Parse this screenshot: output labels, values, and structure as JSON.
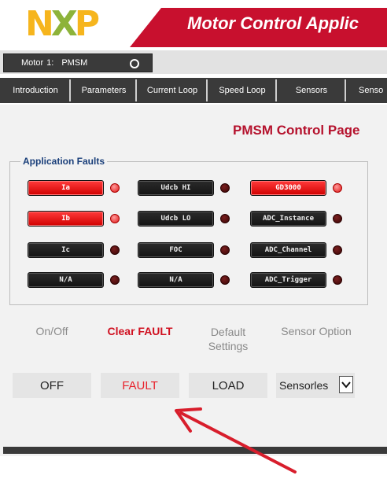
{
  "header": {
    "logo": {
      "n": "N",
      "x": "X",
      "p": "P"
    },
    "title": "Motor Control Applic"
  },
  "motor_selector": {
    "label": "Motor",
    "number": "1:",
    "value": "PMSM"
  },
  "tabs": [
    {
      "label": "Introduction"
    },
    {
      "label": "Parameters"
    },
    {
      "label": "Current Loop"
    },
    {
      "label": "Speed Loop"
    },
    {
      "label": "Sensors"
    },
    {
      "label": "Senso"
    }
  ],
  "page_title": "PMSM Control Page",
  "faults": {
    "legend": "Application Faults",
    "items": [
      {
        "label": "Ia",
        "active": true
      },
      {
        "label": "Udcb HI",
        "active": false
      },
      {
        "label": "GD3000",
        "active": true
      },
      {
        "label": "Ib",
        "active": true
      },
      {
        "label": "Udcb LO",
        "active": false
      },
      {
        "label": "ADC_Instance",
        "active": false
      },
      {
        "label": "Ic",
        "active": false
      },
      {
        "label": "FOC",
        "active": false
      },
      {
        "label": "ADC_Channel",
        "active": false
      },
      {
        "label": "N/A",
        "active": false
      },
      {
        "label": "N/A",
        "active": false
      },
      {
        "label": "ADC_Trigger",
        "active": false
      }
    ]
  },
  "controls": {
    "onoff_label": "On/Off",
    "clear_fault_label": "Clear FAULT",
    "default_label_1": "Default",
    "default_label_2": "Settings",
    "sensor_label": "Sensor Option",
    "off_button": "OFF",
    "fault_button": "FAULT",
    "load_button": "LOAD",
    "sensor_value": "Sensorles"
  },
  "colors": {
    "brand_red": "#c8102e",
    "title_red": "#b5122d",
    "fault_red": "#e8202a",
    "dark_bar": "#3a3a3a",
    "arrow_red": "#d81e2c"
  },
  "icons": {
    "motor_status": "ring-icon",
    "dropdown": "chevron-down-icon",
    "annotation": "arrow-icon"
  }
}
